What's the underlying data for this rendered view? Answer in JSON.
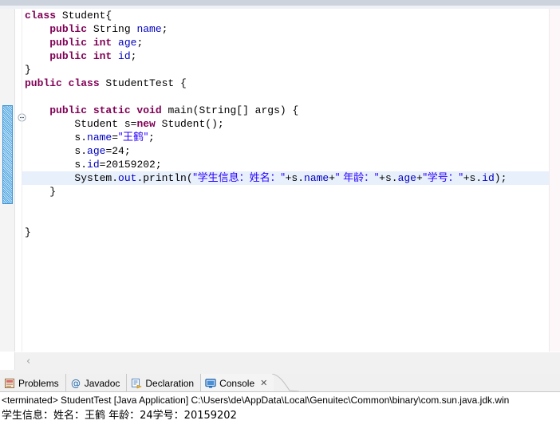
{
  "editor": {
    "name": "java-source-editor",
    "fold_icon": "collapse-fold-icon",
    "highlighted_line_index": 10,
    "change_bar_tooltip": "",
    "lines": [
      {
        "indent": 0,
        "tokens": [
          {
            "t": "class ",
            "c": "kw"
          },
          {
            "t": "Student{",
            "c": "plain"
          }
        ]
      },
      {
        "indent": 1,
        "tokens": [
          {
            "t": "public ",
            "c": "kw"
          },
          {
            "t": "String ",
            "c": "plain"
          },
          {
            "t": "name",
            "c": "fld"
          },
          {
            "t": ";",
            "c": "plain"
          }
        ]
      },
      {
        "indent": 1,
        "tokens": [
          {
            "t": "public int ",
            "c": "kw"
          },
          {
            "t": "age",
            "c": "fld"
          },
          {
            "t": ";",
            "c": "plain"
          }
        ]
      },
      {
        "indent": 1,
        "tokens": [
          {
            "t": "public int ",
            "c": "kw"
          },
          {
            "t": "id",
            "c": "fld"
          },
          {
            "t": ";",
            "c": "plain"
          }
        ]
      },
      {
        "indent": 0,
        "tokens": [
          {
            "t": "}",
            "c": "plain"
          }
        ]
      },
      {
        "indent": 0,
        "tokens": [
          {
            "t": "public class ",
            "c": "kw"
          },
          {
            "t": "StudentTest {",
            "c": "plain"
          }
        ]
      },
      {
        "indent": 0,
        "tokens": [
          {
            "t": "",
            "c": "plain"
          }
        ]
      },
      {
        "indent": 1,
        "tokens": [
          {
            "t": "public static void ",
            "c": "kw"
          },
          {
            "t": "main(String[] args) {",
            "c": "plain"
          }
        ]
      },
      {
        "indent": 2,
        "tokens": [
          {
            "t": "Student s=",
            "c": "plain"
          },
          {
            "t": "new ",
            "c": "kw"
          },
          {
            "t": "Student();",
            "c": "plain"
          }
        ]
      },
      {
        "indent": 2,
        "tokens": [
          {
            "t": "s.",
            "c": "plain"
          },
          {
            "t": "name",
            "c": "fld"
          },
          {
            "t": "=",
            "c": "plain"
          },
          {
            "t": "\"王鹤\"",
            "c": "str"
          },
          {
            "t": ";",
            "c": "plain"
          }
        ]
      },
      {
        "indent": 2,
        "tokens": [
          {
            "t": "s.",
            "c": "plain"
          },
          {
            "t": "age",
            "c": "fld"
          },
          {
            "t": "=24;",
            "c": "plain"
          }
        ]
      },
      {
        "indent": 2,
        "tokens": [
          {
            "t": "s.",
            "c": "plain"
          },
          {
            "t": "id",
            "c": "fld"
          },
          {
            "t": "=20159202;",
            "c": "plain"
          }
        ]
      },
      {
        "indent": 2,
        "tokens": [
          {
            "t": "System.",
            "c": "plain"
          },
          {
            "t": "out",
            "c": "fld"
          },
          {
            "t": ".println(",
            "c": "plain"
          },
          {
            "t": "\"学生信息：姓名：\"",
            "c": "str"
          },
          {
            "t": "+s.",
            "c": "plain"
          },
          {
            "t": "name",
            "c": "fld"
          },
          {
            "t": "+",
            "c": "plain"
          },
          {
            "t": "\" 年龄：\"",
            "c": "str"
          },
          {
            "t": "+s.",
            "c": "plain"
          },
          {
            "t": "age",
            "c": "fld"
          },
          {
            "t": "+",
            "c": "plain"
          },
          {
            "t": "\"学号：\"",
            "c": "str"
          },
          {
            "t": "+s.",
            "c": "plain"
          },
          {
            "t": "id",
            "c": "fld"
          },
          {
            "t": ");",
            "c": "plain"
          }
        ]
      },
      {
        "indent": 1,
        "tokens": [
          {
            "t": "}",
            "c": "plain"
          }
        ]
      },
      {
        "indent": 0,
        "tokens": [
          {
            "t": "",
            "c": "plain"
          }
        ]
      },
      {
        "indent": 0,
        "tokens": [
          {
            "t": "",
            "c": "plain"
          }
        ]
      },
      {
        "indent": 0,
        "tokens": [
          {
            "t": "}",
            "c": "plain"
          }
        ]
      }
    ]
  },
  "scrollbar": {
    "chevron": "‹"
  },
  "bottom_panel": {
    "tabs": [
      {
        "label": "Problems",
        "icon": "problems-icon",
        "active": false,
        "closable": false
      },
      {
        "label": "Javadoc",
        "icon": "javadoc-at-icon",
        "active": false,
        "closable": false
      },
      {
        "label": "Declaration",
        "icon": "declaration-icon",
        "active": false,
        "closable": false
      },
      {
        "label": "Console",
        "icon": "console-monitor-icon",
        "active": true,
        "closable": true
      }
    ],
    "close_glyph": "✕"
  },
  "console": {
    "terminated_line": "<terminated> StudentTest [Java Application] C:\\Users\\de\\AppData\\Local\\Genuitec\\Common\\binary\\com.sun.java.jdk.win",
    "output_line": "学生信息：姓名：王鹤 年龄：24学号：20159202"
  },
  "colors": {
    "keyword": "#7f0055",
    "field": "#0000c0",
    "string": "#2a00ff",
    "line_highlight": "#e8f0fc",
    "change_bar": "#4aa3e0"
  }
}
